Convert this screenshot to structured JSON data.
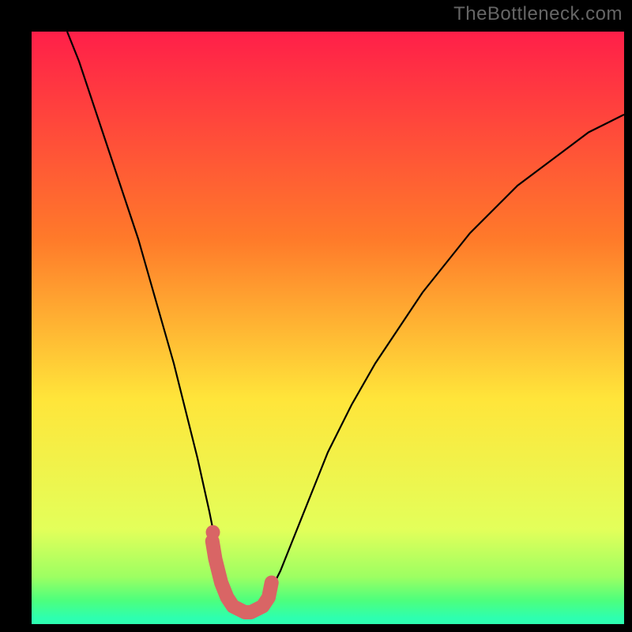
{
  "watermark": "TheBottleneck.com",
  "colors": {
    "bg_black": "#000000",
    "gradient_top": "#ff1f49",
    "gradient_mid_upper": "#ff7a2a",
    "gradient_mid": "#ffe53a",
    "gradient_lower": "#e3ff5a",
    "gradient_green1": "#9dff62",
    "gradient_green2": "#4dff7d",
    "gradient_green3": "#2dffb0",
    "curve": "#000000",
    "highlight_marker": "#d96565"
  },
  "chart_data": {
    "type": "line",
    "title": "",
    "xlabel": "",
    "ylabel": "",
    "xlim": [
      0,
      100
    ],
    "ylim": [
      0,
      100
    ],
    "series": [
      {
        "name": "bottleneck-curve",
        "x": [
          6,
          8,
          10,
          12,
          14,
          16,
          18,
          20,
          22,
          24,
          26,
          28,
          30,
          31,
          32,
          33,
          34,
          35,
          36,
          37,
          38,
          39,
          40,
          42,
          44,
          46,
          48,
          50,
          54,
          58,
          62,
          66,
          70,
          74,
          78,
          82,
          86,
          90,
          94,
          98,
          100
        ],
        "y": [
          100,
          95,
          89,
          83,
          77,
          71,
          65,
          58,
          51,
          44,
          36,
          28,
          19,
          14,
          10,
          6,
          3.5,
          2.5,
          2,
          2,
          2.5,
          3.5,
          5,
          9,
          14,
          19,
          24,
          29,
          37,
          44,
          50,
          56,
          61,
          66,
          70,
          74,
          77,
          80,
          83,
          85,
          86
        ]
      }
    ],
    "highlight_region": {
      "name": "optimal-range",
      "x": [
        30.5,
        31,
        32,
        33,
        34,
        35,
        36,
        37,
        38,
        39,
        40,
        40.5
      ],
      "y": [
        14,
        11,
        7,
        4.5,
        3,
        2.5,
        2,
        2,
        2.5,
        3,
        4.5,
        7
      ]
    },
    "highlight_point": {
      "x": 30.6,
      "y": 15.5
    }
  }
}
